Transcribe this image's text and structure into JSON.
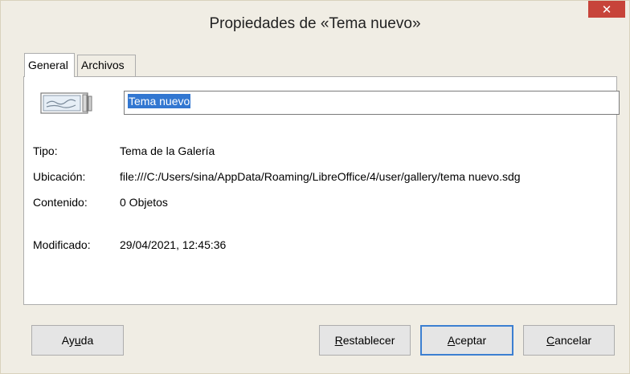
{
  "window": {
    "title": "Propiedades de «Tema nuevo»"
  },
  "tabs": [
    {
      "label": "General"
    },
    {
      "label": "Archivos"
    }
  ],
  "general": {
    "name_value": "Tema nuevo",
    "properties": [
      {
        "label": "Tipo:",
        "value": "Tema de la Galería"
      },
      {
        "label": "Ubicación:",
        "value": "file:///C:/Users/sina/AppData/Roaming/LibreOffice/4/user/gallery/tema nuevo.sdg"
      },
      {
        "label": "Contenido:",
        "value": "0 Objetos"
      },
      {
        "label": "Modificado:",
        "value": "29/04/2021, 12:45:36"
      }
    ]
  },
  "buttons": {
    "help": {
      "pre": "Ay",
      "mnemonic": "u",
      "post": "da"
    },
    "reset": {
      "pre": "",
      "mnemonic": "R",
      "post": "establecer"
    },
    "ok": {
      "pre": "",
      "mnemonic": "A",
      "post": "ceptar"
    },
    "cancel": {
      "pre": "",
      "mnemonic": "C",
      "post": "ancelar"
    }
  },
  "colors": {
    "close_button": "#c7443a",
    "selection": "#3277d1",
    "default_button_border": "#3c7fd1"
  }
}
